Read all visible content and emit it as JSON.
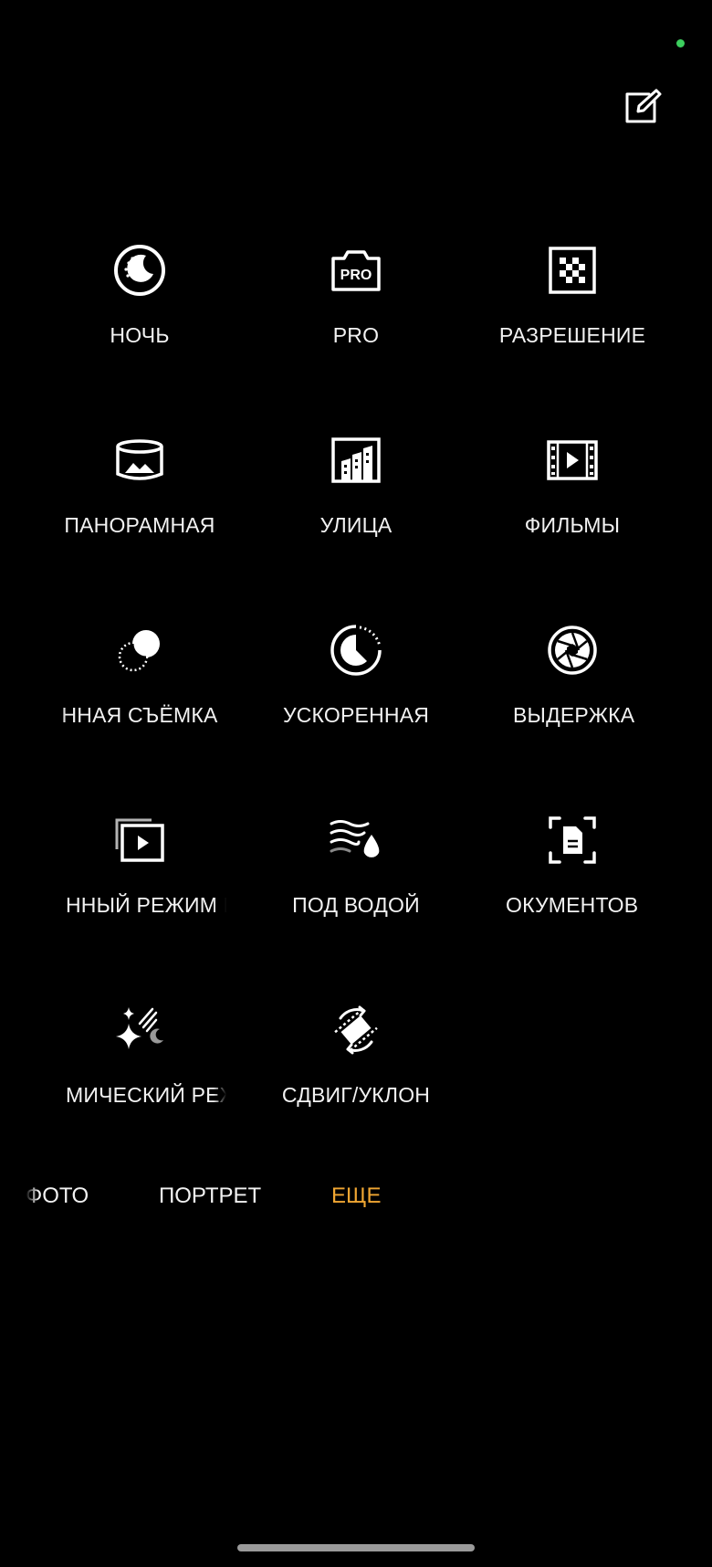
{
  "status": {
    "indicator_color": "#3ccf5e"
  },
  "toolbar": {
    "edit_icon": "edit-icon"
  },
  "modes": [
    {
      "label": "НОЧЬ",
      "icon": "night-icon"
    },
    {
      "label": "PRO",
      "icon": "pro-camera-icon",
      "icon_text": "PRO"
    },
    {
      "label": "РАЗРЕШЕНИЕ",
      "icon": "resolution-icon"
    },
    {
      "label": "ПАНОРАМНАЯ",
      "icon": "panorama-icon"
    },
    {
      "label": "УЛИЦА",
      "icon": "street-icon"
    },
    {
      "label": "ФИЛЬМЫ",
      "icon": "film-icon"
    },
    {
      "label": "ННАЯ СЪЁМКА",
      "icon": "dual-exposure-icon"
    },
    {
      "label": "УСКОРЕННАЯ",
      "icon": "time-lapse-icon"
    },
    {
      "label": "ВЫДЕРЖКА",
      "icon": "shutter-aperture-icon"
    },
    {
      "label": "ННЫЙ РЕЖИМ В",
      "icon": "video-mode-icon"
    },
    {
      "label": "ПОД ВОДОЙ",
      "icon": "underwater-icon"
    },
    {
      "label": "ОКУМЕНТОВ",
      "icon": "document-scan-icon"
    },
    {
      "label": "МИЧЕСКИЙ РЕЖ",
      "icon": "cosmic-icon"
    },
    {
      "label": "СДВИГ/УКЛОН",
      "icon": "tilt-shift-icon"
    }
  ],
  "bottom_tabs": [
    {
      "label": "ФОТО",
      "active": false
    },
    {
      "label": "ПОРТРЕТ",
      "active": false
    },
    {
      "label": "ЕЩЕ",
      "active": true
    }
  ],
  "colors": {
    "accent": "#f0a632",
    "text": "#f2f2f2",
    "background": "#000000"
  }
}
